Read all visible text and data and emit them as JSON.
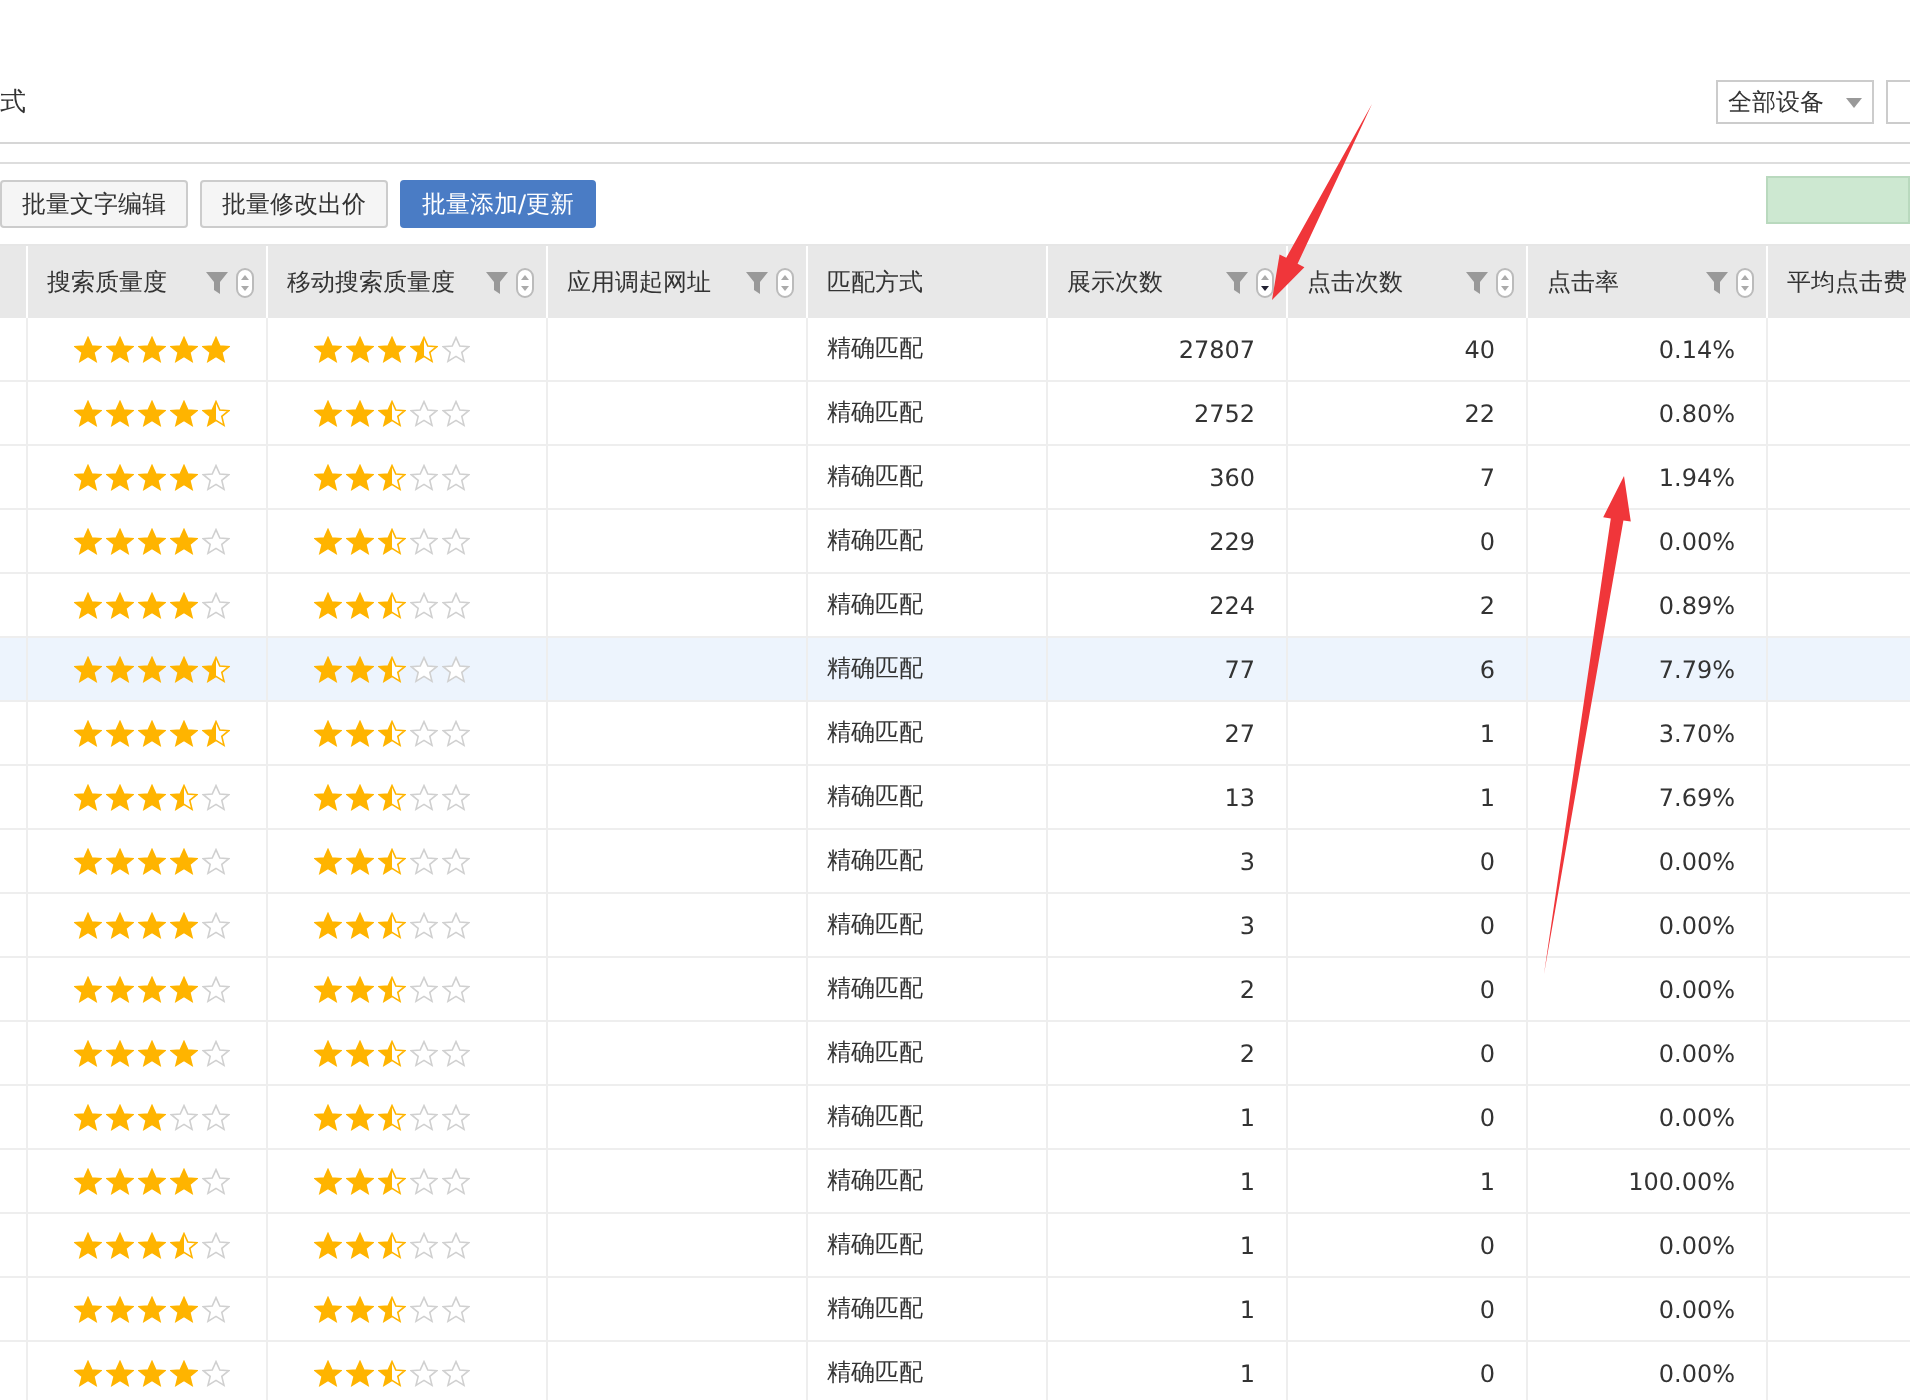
{
  "header": {
    "title_fragment": "式",
    "device_select": {
      "value": "全部设备"
    }
  },
  "toolbar": {
    "buttons": [
      {
        "label": "批量文字编辑",
        "kind": "plain"
      },
      {
        "label": "批量修改出价",
        "kind": "plain"
      },
      {
        "label": "批量添加/更新",
        "kind": "primary"
      }
    ]
  },
  "table": {
    "columns": [
      {
        "kind": "blank"
      },
      {
        "label": "搜索质量度",
        "kind": "filter",
        "sorted": false
      },
      {
        "label": "移动搜索质量度",
        "kind": "filter",
        "sorted": false
      },
      {
        "label": "应用调起网址",
        "kind": "filter",
        "sorted": false
      },
      {
        "label": "匹配方式",
        "kind": "plain"
      },
      {
        "label": "展示次数",
        "kind": "filter",
        "sorted": true
      },
      {
        "label": "点击次数",
        "kind": "filter",
        "sorted": false
      },
      {
        "label": "点击率",
        "kind": "filter",
        "sorted": false
      },
      {
        "label": "平均点击费",
        "kind": "plain"
      }
    ],
    "rows": [
      {
        "search_quality": {
          "stars": 5
        },
        "mobile_quality": {
          "stars": 3.5
        },
        "match": "精确匹配",
        "impressions": "27807",
        "clicks": "40",
        "ctr": "0.14%",
        "selected": false
      },
      {
        "search_quality": {
          "stars": 4.5
        },
        "mobile_quality": {
          "stars": 2.5
        },
        "match": "精确匹配",
        "impressions": "2752",
        "clicks": "22",
        "ctr": "0.80%",
        "selected": false
      },
      {
        "search_quality": {
          "stars": 4
        },
        "mobile_quality": {
          "stars": 2.5
        },
        "match": "精确匹配",
        "impressions": "360",
        "clicks": "7",
        "ctr": "1.94%",
        "selected": false
      },
      {
        "search_quality": {
          "stars": 4
        },
        "mobile_quality": {
          "stars": 2.5
        },
        "match": "精确匹配",
        "impressions": "229",
        "clicks": "0",
        "ctr": "0.00%",
        "selected": false
      },
      {
        "search_quality": {
          "stars": 4
        },
        "mobile_quality": {
          "stars": 2.5
        },
        "match": "精确匹配",
        "impressions": "224",
        "clicks": "2",
        "ctr": "0.89%",
        "selected": false
      },
      {
        "search_quality": {
          "stars": 4.5
        },
        "mobile_quality": {
          "stars": 2.5
        },
        "match": "精确匹配",
        "impressions": "77",
        "clicks": "6",
        "ctr": "7.79%",
        "selected": true
      },
      {
        "search_quality": {
          "stars": 4.5
        },
        "mobile_quality": {
          "stars": 2.5
        },
        "match": "精确匹配",
        "impressions": "27",
        "clicks": "1",
        "ctr": "3.70%",
        "selected": false
      },
      {
        "search_quality": {
          "stars": 3.5
        },
        "mobile_quality": {
          "stars": 2.5
        },
        "match": "精确匹配",
        "impressions": "13",
        "clicks": "1",
        "ctr": "7.69%",
        "selected": false
      },
      {
        "search_quality": {
          "stars": 4
        },
        "mobile_quality": {
          "stars": 2.5
        },
        "match": "精确匹配",
        "impressions": "3",
        "clicks": "0",
        "ctr": "0.00%",
        "selected": false
      },
      {
        "search_quality": {
          "stars": 4
        },
        "mobile_quality": {
          "stars": 2.5
        },
        "match": "精确匹配",
        "impressions": "3",
        "clicks": "0",
        "ctr": "0.00%",
        "selected": false
      },
      {
        "search_quality": {
          "stars": 4
        },
        "mobile_quality": {
          "stars": 2.5
        },
        "match": "精确匹配",
        "impressions": "2",
        "clicks": "0",
        "ctr": "0.00%",
        "selected": false
      },
      {
        "search_quality": {
          "stars": 4
        },
        "mobile_quality": {
          "stars": 2.5
        },
        "match": "精确匹配",
        "impressions": "2",
        "clicks": "0",
        "ctr": "0.00%",
        "selected": false
      },
      {
        "search_quality": {
          "stars": 3
        },
        "mobile_quality": {
          "stars": 2.5
        },
        "match": "精确匹配",
        "impressions": "1",
        "clicks": "0",
        "ctr": "0.00%",
        "selected": false
      },
      {
        "search_quality": {
          "stars": 4
        },
        "mobile_quality": {
          "stars": 2.5
        },
        "match": "精确匹配",
        "impressions": "1",
        "clicks": "1",
        "ctr": "100.00%",
        "selected": false
      },
      {
        "search_quality": {
          "stars": 3.5
        },
        "mobile_quality": {
          "stars": 2.5
        },
        "match": "精确匹配",
        "impressions": "1",
        "clicks": "0",
        "ctr": "0.00%",
        "selected": false
      },
      {
        "search_quality": {
          "stars": 4
        },
        "mobile_quality": {
          "stars": 2.5
        },
        "match": "精确匹配",
        "impressions": "1",
        "clicks": "0",
        "ctr": "0.00%",
        "selected": false
      },
      {
        "search_quality": {
          "stars": 4
        },
        "mobile_quality": {
          "stars": 2.5
        },
        "match": "精确匹配",
        "impressions": "1",
        "clicks": "0",
        "ctr": "0.00%",
        "selected": false
      }
    ]
  },
  "annotations": [
    {
      "kind": "arrow"
    },
    {
      "kind": "arrow"
    }
  ]
}
